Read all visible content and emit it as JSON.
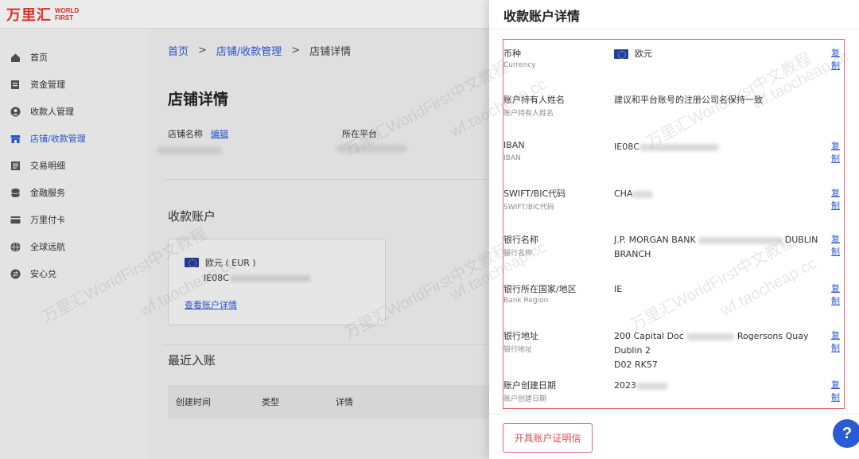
{
  "brand": {
    "logo_cn": "万里汇",
    "logo_en_line1": "WORLD",
    "logo_en_line2": "FIRST"
  },
  "sidebar": {
    "items": [
      {
        "label": "首页",
        "icon": "home-icon"
      },
      {
        "label": "资金管理",
        "icon": "ledger-icon"
      },
      {
        "label": "收款人管理",
        "icon": "user-icon"
      },
      {
        "label": "店铺/收款管理",
        "icon": "shop-icon",
        "active": true
      },
      {
        "label": "交易明细",
        "icon": "list-icon"
      },
      {
        "label": "金融服务",
        "icon": "coins-icon"
      },
      {
        "label": "万里付卡",
        "icon": "card-icon"
      },
      {
        "label": "全球远航",
        "icon": "globe-icon"
      },
      {
        "label": "安心兑",
        "icon": "exchange-icon"
      }
    ]
  },
  "breadcrumb": {
    "home": "首页",
    "shops": "店铺/收款管理",
    "current": "店铺详情",
    "sep": ">"
  },
  "main": {
    "title": "店铺详情",
    "shop_name_label": "店铺名称",
    "edit_label": "编辑",
    "platform_label": "所在平台",
    "receive_title": "收款账户",
    "card": {
      "currency": "欧元 ( EUR )",
      "iban": "IE08C",
      "link": "查看账户详情"
    },
    "recent_title": "最近入账",
    "table_headers": [
      "创建时间",
      "类型",
      "详情"
    ]
  },
  "drawer": {
    "title": "收款账户详情",
    "rows": [
      {
        "label": "币种",
        "sub": "Currency",
        "value": "欧元",
        "flag": true,
        "copy": "复制"
      },
      {
        "label": "账户持有人姓名",
        "sub": "账户持有人姓名",
        "value": "建议和平台账号的注册公司名保持一致",
        "copy": ""
      },
      {
        "label": "IBAN",
        "sub": "IBAN",
        "value": "IE08C",
        "copy": "复制"
      },
      {
        "label": "SWIFT/BIC代码",
        "sub": "SWIFT/BIC代码",
        "value": "CHA",
        "copy": "复制"
      },
      {
        "label": "银行名称",
        "sub": "银行名称",
        "value": "J.P. MORGAN BANK",
        "value2": "BRANCH",
        "value_tail": "DUBLIN",
        "copy": "复制"
      },
      {
        "label": "银行所在国家/地区",
        "sub": "Bank Region",
        "value": "IE",
        "copy": "复制"
      },
      {
        "label": "银行地址",
        "sub": "银行地址",
        "value": "200 Capital Doc",
        "value_tail": "Rogersons Quay Dublin 2",
        "value2": "D02 RK57",
        "copy": "复制"
      },
      {
        "label": "账户创建日期",
        "sub": "账户创建日期",
        "value": "2023",
        "copy": "复制"
      }
    ],
    "certificate_button": "开具账户证明信"
  },
  "help_label": "?",
  "watermark": {
    "line1": "万里汇WorldFirst中文教程",
    "line2": "wf.taocheap.cc"
  }
}
